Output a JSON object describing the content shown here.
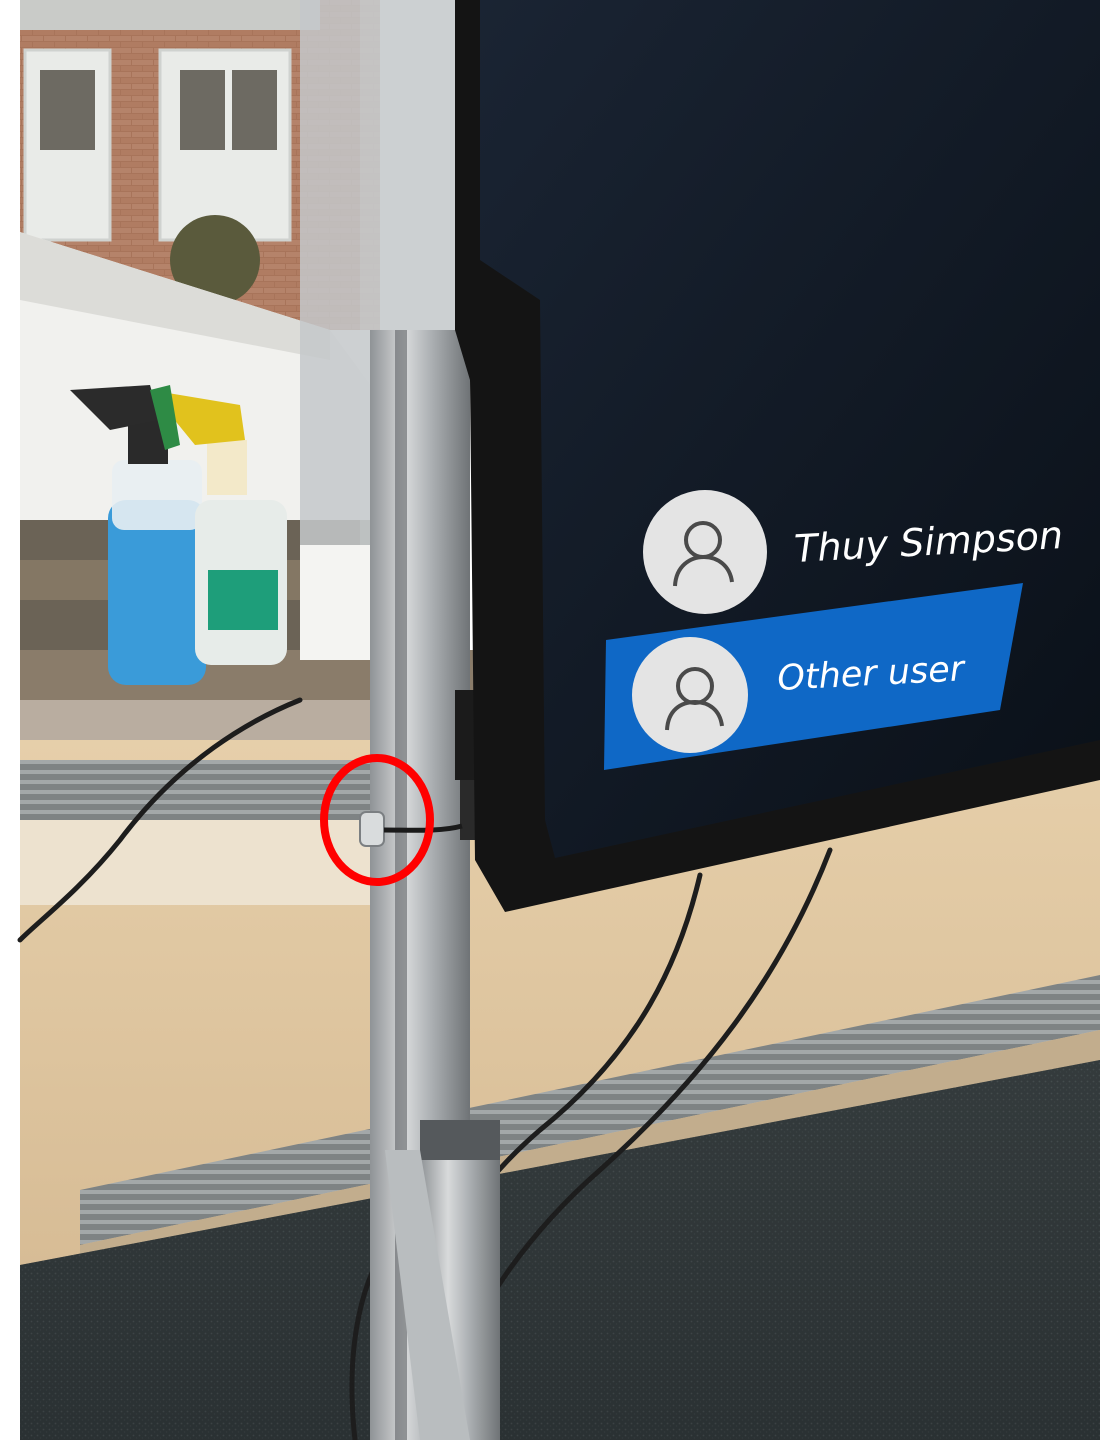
{
  "screen": {
    "users": [
      {
        "name": "Thuy Simpson",
        "selected": false,
        "avatar_icon": "user-silhouette-icon"
      },
      {
        "name": "Other user",
        "selected": true,
        "avatar_icon": "user-silhouette-icon"
      }
    ],
    "background_color": "#0e1622",
    "selection_color": "#0f68c6"
  },
  "annotation": {
    "shape": "circle",
    "color": "#ff0000",
    "target": "cable lock on stand"
  }
}
